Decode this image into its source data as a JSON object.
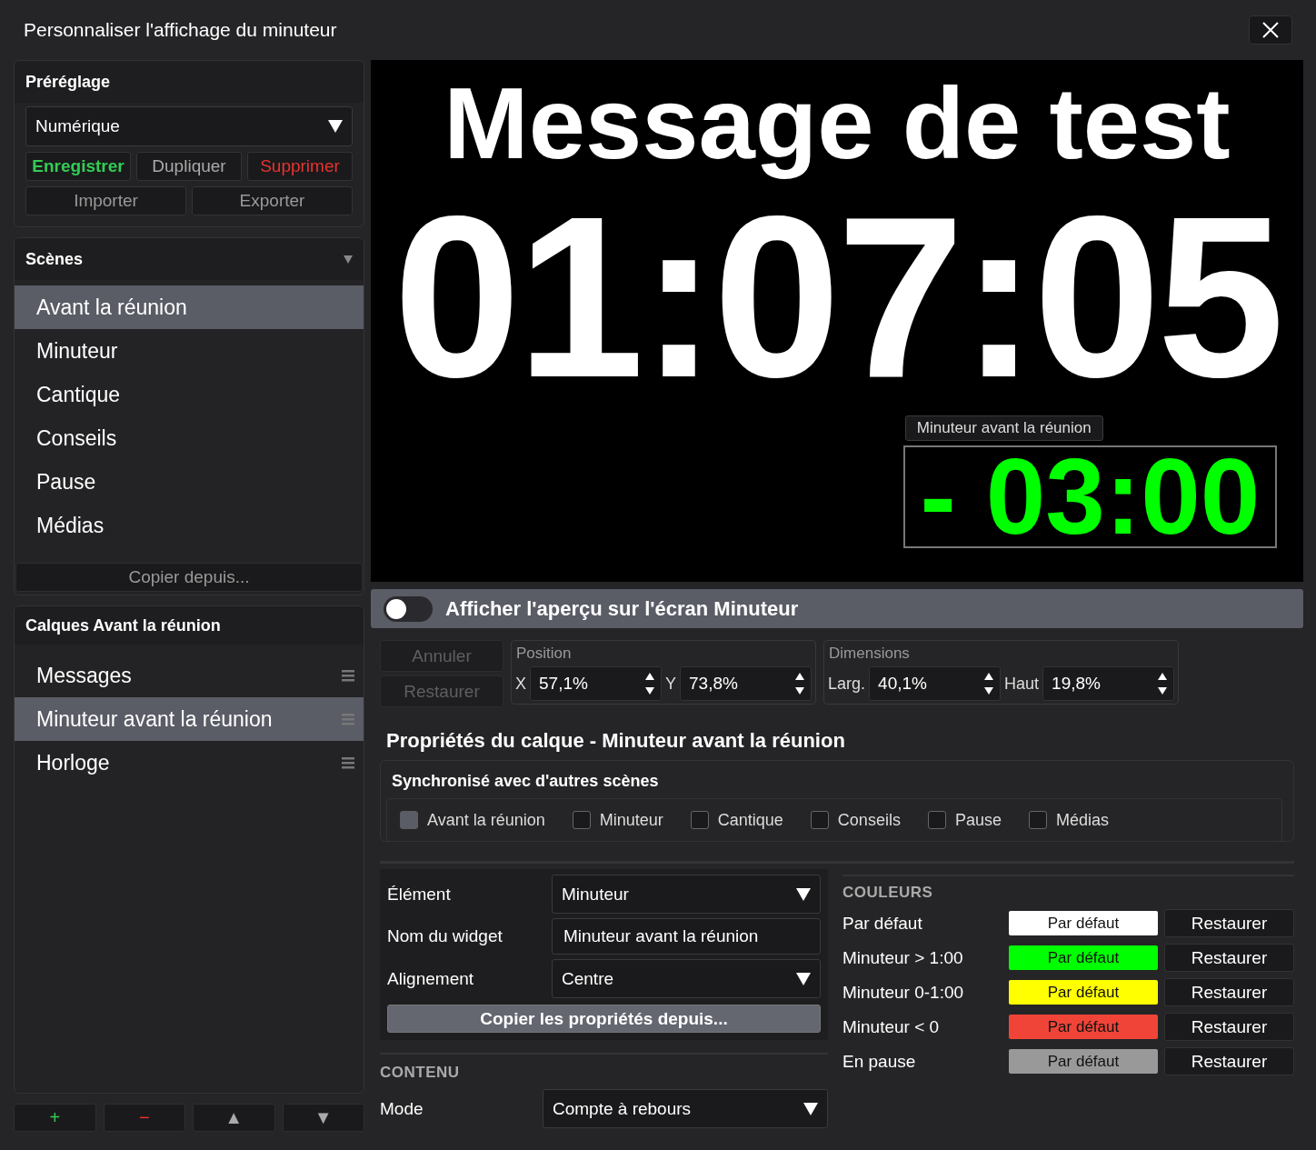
{
  "window": {
    "title": "Personnaliser l'affichage du minuteur"
  },
  "preset": {
    "title": "Préréglage",
    "value": "Numérique",
    "buttons": [
      {
        "label": "Enregistrer",
        "kind": "save"
      },
      {
        "label": "Dupliquer",
        "kind": "normal"
      },
      {
        "label": "Supprimer",
        "kind": "danger"
      }
    ],
    "io_buttons": [
      {
        "label": "Importer"
      },
      {
        "label": "Exporter"
      }
    ]
  },
  "scenes": {
    "title": "Scènes",
    "expanded": true,
    "items": [
      {
        "label": "Avant la réunion",
        "selected": true
      },
      {
        "label": "Minuteur",
        "selected": false
      },
      {
        "label": "Cantique",
        "selected": false
      },
      {
        "label": "Conseils",
        "selected": false
      },
      {
        "label": "Pause",
        "selected": false
      },
      {
        "label": "Médias",
        "selected": false
      }
    ],
    "copy_button": "Copier depuis..."
  },
  "layers": {
    "title": "Calques Avant la réunion",
    "items": [
      {
        "label": "Messages",
        "selected": false
      },
      {
        "label": "Minuteur avant la réunion",
        "selected": true
      },
      {
        "label": "Horloge",
        "selected": false
      }
    ],
    "buttons": [
      {
        "label": "+",
        "kind": "add"
      },
      {
        "label": "−",
        "kind": "remove"
      },
      {
        "label": "▲",
        "kind": "up"
      },
      {
        "label": "▼",
        "kind": "down"
      }
    ]
  },
  "preview": {
    "message": "Message de test",
    "clock": "01:07:05",
    "widget": {
      "label": "Minuteur avant la réunion",
      "value": "- 03:00"
    }
  },
  "preview_toggle": {
    "label": "Afficher l'aperçu sur l'écran Minuteur",
    "on": false
  },
  "history": [
    {
      "label": "Annuler",
      "disabled": true
    },
    {
      "label": "Restaurer",
      "disabled": true
    }
  ],
  "position": {
    "title": "Position",
    "fields": [
      {
        "label": "X",
        "value": "57,1%"
      },
      {
        "label": "Y",
        "value": "73,8%"
      }
    ]
  },
  "dimensions": {
    "title": "Dimensions",
    "fields": [
      {
        "label": "Larg.",
        "value": "40,1%"
      },
      {
        "label": "Haut",
        "value": "19,8%"
      }
    ]
  },
  "layer_properties": {
    "title": "Propriétés du calque - Minuteur avant la réunion",
    "sync": {
      "title": "Synchronisé avec d'autres scènes",
      "scenes": [
        {
          "label": "Avant la réunion",
          "checked": false,
          "disabled": true
        },
        {
          "label": "Minuteur",
          "checked": false,
          "disabled": false
        },
        {
          "label": "Cantique",
          "checked": false,
          "disabled": false
        },
        {
          "label": "Conseils",
          "checked": false,
          "disabled": false
        },
        {
          "label": "Pause",
          "checked": false,
          "disabled": false
        },
        {
          "label": "Médias",
          "checked": false,
          "disabled": false
        }
      ]
    }
  },
  "element_form": {
    "rows": [
      {
        "label": "Élément",
        "value": "Minuteur",
        "kind": "dropdown"
      },
      {
        "label": "Nom du widget",
        "value": "Minuteur avant la réunion",
        "kind": "text"
      },
      {
        "label": "Alignement",
        "value": "Centre",
        "kind": "dropdown"
      }
    ],
    "copy_button": "Copier les propriétés depuis..."
  },
  "content": {
    "title": "CONTENU",
    "rows": [
      {
        "label": "Mode",
        "value": "Compte à rebours",
        "kind": "dropdown"
      }
    ]
  },
  "colors": {
    "title": "COULEURS",
    "items": [
      {
        "label": "Par défaut",
        "swatch": "Par défaut",
        "color": "#ffffff",
        "reset": "Restaurer"
      },
      {
        "label": "Minuteur > 1:00",
        "swatch": "Par défaut",
        "color": "#00ff00",
        "reset": "Restaurer"
      },
      {
        "label": "Minuteur 0-1:00",
        "swatch": "Par défaut",
        "color": "#ffff00",
        "reset": "Restaurer"
      },
      {
        "label": "Minuteur < 0",
        "swatch": "Par défaut",
        "color": "#f04438",
        "reset": "Restaurer"
      },
      {
        "label": "En pause",
        "swatch": "Par défaut",
        "color": "#999999",
        "reset": "Restaurer"
      }
    ]
  }
}
